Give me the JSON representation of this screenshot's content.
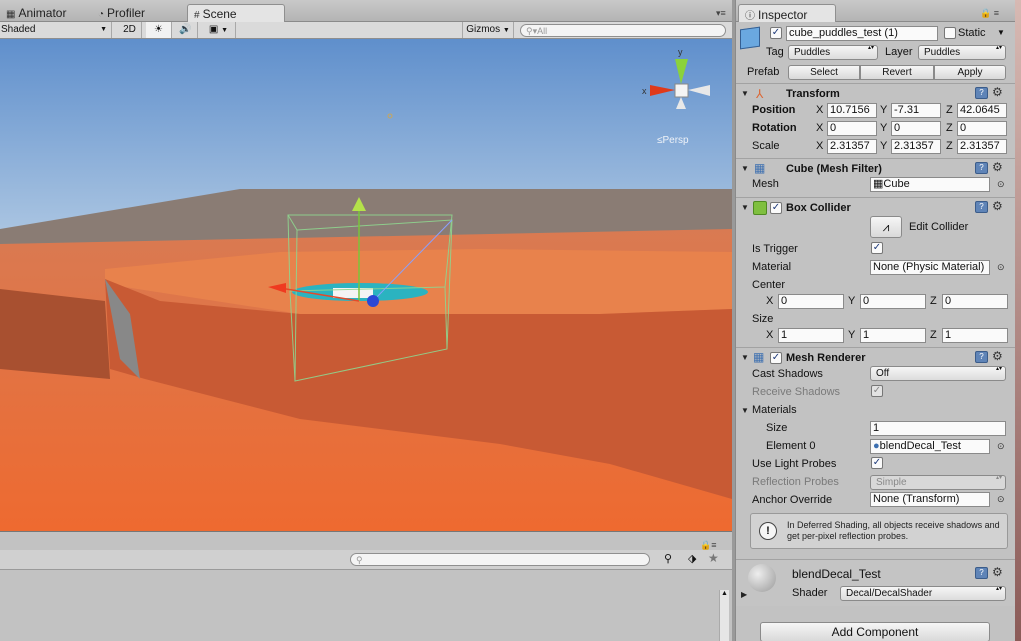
{
  "tabs": {
    "animator": "Animator",
    "profiler": "Profiler",
    "scene": "Scene"
  },
  "scene_toolbar": {
    "shading": "Shaded",
    "mode_2d": "2D",
    "gizmos": "Gizmos",
    "search_placeholder": "All"
  },
  "viewport": {
    "gizmo_x": "x",
    "gizmo_y": "y",
    "persp": "Persp"
  },
  "inspector": {
    "title": "Inspector",
    "object_name": "cube_puddles_test (1)",
    "static_label": "Static",
    "tag_label": "Tag",
    "tag_value": "Puddles",
    "layer_label": "Layer",
    "layer_value": "Puddles",
    "prefab_label": "Prefab",
    "prefab_select": "Select",
    "prefab_revert": "Revert",
    "prefab_apply": "Apply",
    "transform": {
      "title": "Transform",
      "position_label": "Position",
      "pos_x": "10.7156",
      "pos_y": "-7.31",
      "pos_z": "42.0645",
      "rotation_label": "Rotation",
      "rot_x": "0",
      "rot_y": "0",
      "rot_z": "0",
      "scale_label": "Scale",
      "scale_x": "2.31357",
      "scale_y": "2.31357",
      "scale_z": "2.31357",
      "x": "X",
      "y": "Y",
      "z": "Z"
    },
    "mesh_filter": {
      "title": "Cube (Mesh Filter)",
      "mesh_label": "Mesh",
      "mesh_value": "Cube"
    },
    "box_collider": {
      "title": "Box Collider",
      "edit_collider": "Edit Collider",
      "is_trigger": "Is Trigger",
      "material_label": "Material",
      "material_value": "None (Physic Material)",
      "center_label": "Center",
      "cx": "0",
      "cy": "0",
      "cz": "0",
      "size_label": "Size",
      "sx": "1",
      "sy": "1",
      "sz": "1"
    },
    "mesh_renderer": {
      "title": "Mesh Renderer",
      "cast_shadows": "Cast Shadows",
      "cast_value": "Off",
      "receive_shadows": "Receive Shadows",
      "materials": "Materials",
      "size_label": "Size",
      "size_value": "1",
      "element0_label": "Element 0",
      "element0_value": "blendDecal_Test",
      "light_probes": "Use Light Probes",
      "reflection_probes": "Reflection Probes",
      "reflection_value": "Simple",
      "anchor_override": "Anchor Override",
      "anchor_value": "None (Transform)",
      "info": "In Deferred Shading, all objects receive shadows and get per-pixel reflection probes."
    },
    "material": {
      "name": "blendDecal_Test",
      "shader_label": "Shader",
      "shader_value": "Decal/DecalShader"
    },
    "add_component": "Add Component"
  },
  "colors": {
    "sky_top": "#5f8fcc",
    "terrain": "#e06a3e",
    "puddle": "#2bb3c0",
    "selection": "#8fd68f",
    "panel": "#c2c2c2"
  }
}
